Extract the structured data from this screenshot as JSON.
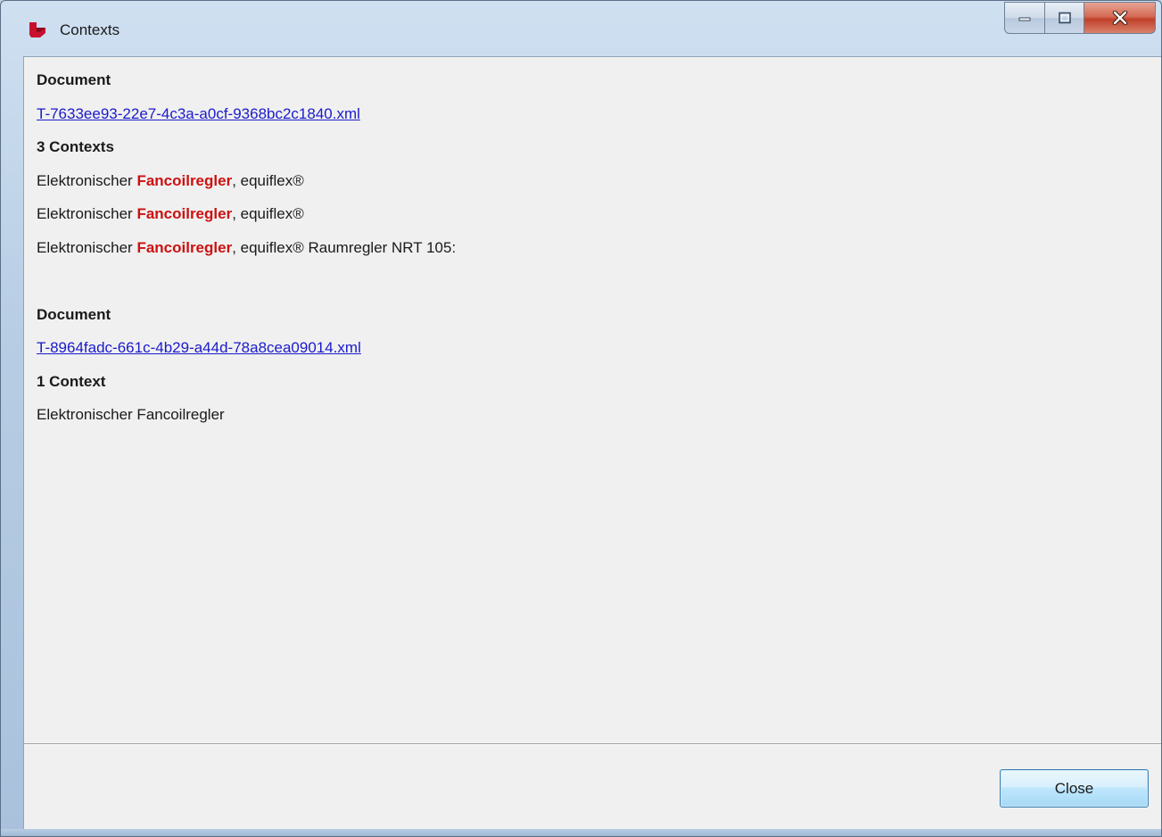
{
  "window": {
    "title": "Contexts"
  },
  "documents": [
    {
      "heading": "Document",
      "file": "T-7633ee93-22e7-4c3a-a0cf-9368bc2c1840.xml",
      "count_label": "3 Contexts",
      "contexts": [
        {
          "before": "Elektronischer ",
          "match": "Fancoilregler",
          "after": ", equiflex®"
        },
        {
          "before": "Elektronischer ",
          "match": "Fancoilregler",
          "after": ", equiflex®"
        },
        {
          "before": "Elektronischer ",
          "match": "Fancoilregler",
          "after": ", equiflex® Raumregler NRT 105:"
        }
      ]
    },
    {
      "heading": "Document",
      "file": "T-8964fadc-661c-4b29-a44d-78a8cea09014.xml",
      "count_label": "1 Context",
      "contexts": [
        {
          "before": "Elektronischer Fancoilregler",
          "match": "",
          "after": ""
        }
      ]
    }
  ],
  "footer": {
    "close_label": "Close"
  },
  "colors": {
    "link": "#1a1acc",
    "highlight": "#cc1111"
  },
  "icons": {
    "app": "app-logo-icon",
    "minimize": "minimize-icon",
    "maximize": "maximize-icon",
    "close": "close-icon"
  }
}
